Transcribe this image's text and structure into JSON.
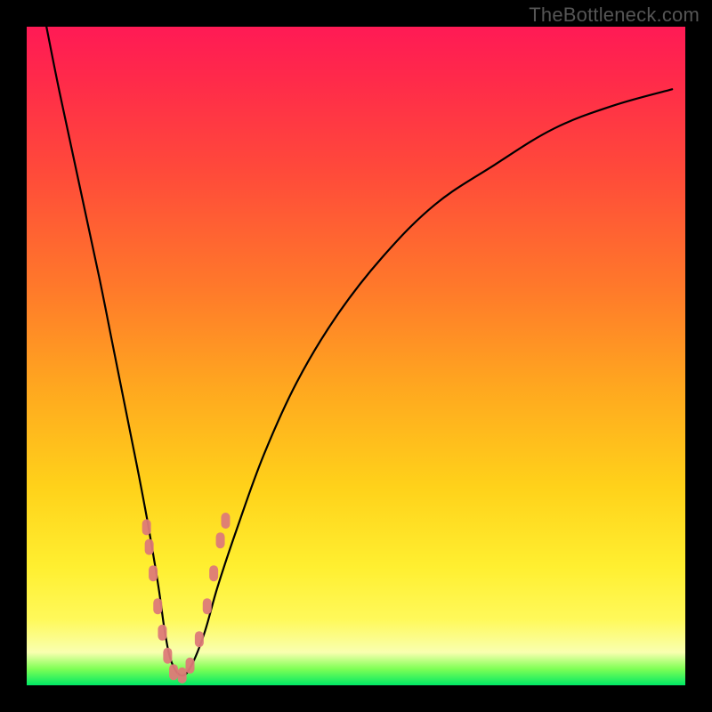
{
  "watermark": "TheBottleneck.com",
  "colors": {
    "frame": "#000000",
    "curve": "#000000",
    "marker": "#dd7a78",
    "gradient_stops": [
      "#ff1a55",
      "#ff7a2a",
      "#ffd21a",
      "#fff95a",
      "#00e865"
    ]
  },
  "chart_data": {
    "type": "line",
    "title": "",
    "xlabel": "",
    "ylabel": "",
    "xlim": [
      0,
      100
    ],
    "ylim": [
      0,
      100
    ],
    "note": "No axis ticks or numeric labels are rendered; values are relative percentages of the plot area. y=0 is bottom.",
    "series": [
      {
        "name": "bottleneck-curve",
        "x": [
          3,
          5,
          8,
          11,
          13,
          15,
          17,
          18.5,
          20,
          21,
          22,
          23.5,
          25,
          27,
          29,
          32,
          36,
          41,
          47,
          54,
          62,
          71,
          80,
          89,
          98
        ],
        "y": [
          100,
          90,
          76,
          62,
          52,
          42,
          32,
          24,
          15,
          8,
          3.5,
          1.5,
          3,
          8,
          15,
          24,
          35,
          46,
          56,
          65,
          73,
          79,
          84.5,
          88,
          90.5
        ]
      }
    ],
    "markers": {
      "name": "highlighted-points",
      "points": [
        {
          "x": 18.2,
          "y": 24
        },
        {
          "x": 18.6,
          "y": 21
        },
        {
          "x": 19.2,
          "y": 17
        },
        {
          "x": 19.9,
          "y": 12
        },
        {
          "x": 20.6,
          "y": 8
        },
        {
          "x": 21.4,
          "y": 4.5
        },
        {
          "x": 22.3,
          "y": 2
        },
        {
          "x": 23.6,
          "y": 1.5
        },
        {
          "x": 24.8,
          "y": 3
        },
        {
          "x": 26.2,
          "y": 7
        },
        {
          "x": 27.4,
          "y": 12
        },
        {
          "x": 28.4,
          "y": 17
        },
        {
          "x": 29.4,
          "y": 22
        },
        {
          "x": 30.2,
          "y": 25
        }
      ]
    }
  }
}
